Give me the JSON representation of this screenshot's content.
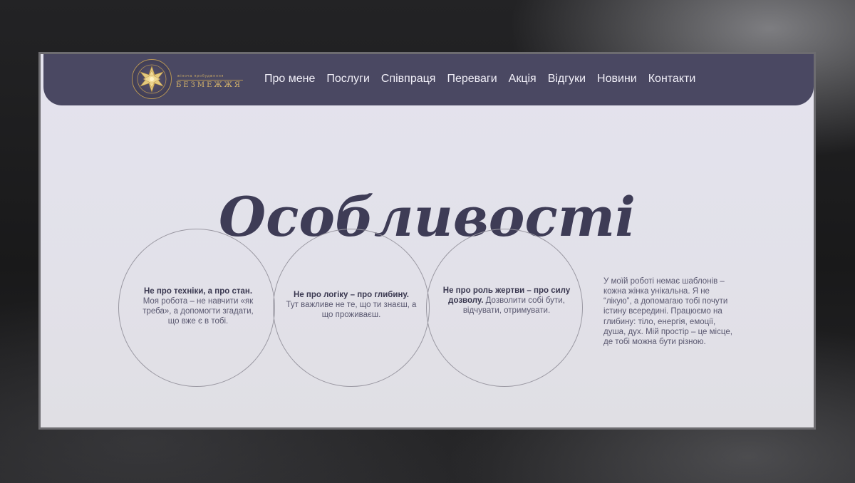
{
  "header": {
    "logo": {
      "icon": "gold-star-mandala-icon",
      "tagline": "жіноча пробудження",
      "name": "БЕЗМЕЖЖЯ"
    },
    "nav": [
      {
        "label": "Про мене"
      },
      {
        "label": "Послуги"
      },
      {
        "label": "Співпраця"
      },
      {
        "label": "Переваги"
      },
      {
        "label": "Акція"
      },
      {
        "label": "Відгуки"
      },
      {
        "label": "Новини"
      },
      {
        "label": "Контакти"
      }
    ]
  },
  "main": {
    "title": "Особливості",
    "circles": [
      {
        "bold": "Не про техніки, а про стан.",
        "text": "Моя робота – не навчити «як треба», а допомогти згадати, що вже є в тобі."
      },
      {
        "bold": "Не про логіку – про глибину.",
        "text": "Тут важливе не те, що ти знаєш, а що проживаєш."
      },
      {
        "bold": "Не про роль жертви – про силу дозволу.",
        "text": "Дозволити собі бути, відчувати, отримувати."
      }
    ],
    "side_text": "У моїй роботі немає шаблонів – кожна жінка унікальна. Я не “лікую”, а допомагаю тобі почути істину всередині. Працюємо на глибину: тіло, енергія, емоції, душа, дух. Мій простір – це місце, де тобі можна бути різною."
  },
  "colors": {
    "header_bg": "#4a4862",
    "accent_gold": "#c9a962",
    "title": "#3e3c56",
    "body_text": "#5a5870",
    "page_bg": "#e4e3ee"
  }
}
